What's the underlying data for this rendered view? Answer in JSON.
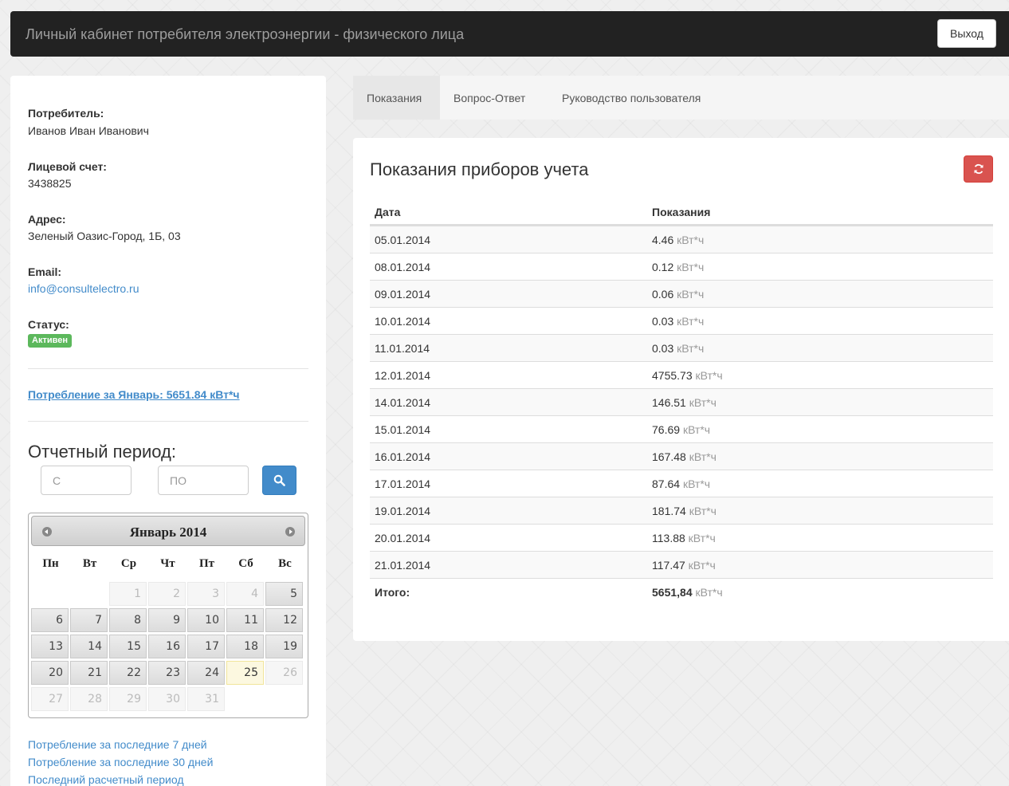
{
  "header": {
    "title": "Личный кабинет потребителя электроэнергии - физического лица",
    "logout_label": "Выход"
  },
  "sidebar": {
    "consumer_label": "Потребитель:",
    "consumer_value": "Иванов Иван Иванович",
    "account_label": "Лицевой счет:",
    "account_value": "3438825",
    "address_label": "Адрес:",
    "address_value": "Зеленый Оазис-Город, 1Б, 03",
    "email_label": "Email:",
    "email_value": "info@consultelectro.ru",
    "status_label": "Статус:",
    "status_value": "Активен",
    "consumption_text": "Потребление за Январь: 5651.84 кВт*ч",
    "period_title": "Отчетный период:",
    "from_placeholder": "С",
    "to_placeholder": "ПО",
    "links": [
      "Потребление за последние 7 дней",
      "Потребление за последние 30 дней",
      "Последний расчетный период"
    ]
  },
  "calendar": {
    "title": "Январь 2014",
    "weekdays": [
      "Пн",
      "Вт",
      "Ср",
      "Чт",
      "Пт",
      "Сб",
      "Вс"
    ],
    "weeks": [
      [
        "",
        "",
        "1",
        "2",
        "3",
        "4",
        "5"
      ],
      [
        "6",
        "7",
        "8",
        "9",
        "10",
        "11",
        "12"
      ],
      [
        "13",
        "14",
        "15",
        "16",
        "17",
        "18",
        "19"
      ],
      [
        "20",
        "21",
        "22",
        "23",
        "24",
        "25",
        "26"
      ],
      [
        "27",
        "28",
        "29",
        "30",
        "31",
        "",
        ""
      ]
    ],
    "disabled_days": [
      "1",
      "2",
      "3",
      "4",
      "26",
      "27",
      "28",
      "29",
      "30",
      "31"
    ],
    "today": "25"
  },
  "tabs": [
    {
      "label": "Показания",
      "active": true
    },
    {
      "label": "Вопрос-Ответ",
      "active": false
    },
    {
      "label": "Руководство пользователя",
      "active": false
    }
  ],
  "readings": {
    "title": "Показания приборов учета",
    "columns": [
      "Дата",
      "Показания"
    ],
    "unit": "кВт*ч",
    "rows": [
      {
        "date": "05.01.2014",
        "value": "4.46"
      },
      {
        "date": "08.01.2014",
        "value": "0.12"
      },
      {
        "date": "09.01.2014",
        "value": "0.06"
      },
      {
        "date": "10.01.2014",
        "value": "0.03"
      },
      {
        "date": "11.01.2014",
        "value": "0.03"
      },
      {
        "date": "12.01.2014",
        "value": "4755.73"
      },
      {
        "date": "14.01.2014",
        "value": "146.51"
      },
      {
        "date": "15.01.2014",
        "value": "76.69"
      },
      {
        "date": "16.01.2014",
        "value": "167.48"
      },
      {
        "date": "17.01.2014",
        "value": "87.64"
      },
      {
        "date": "19.01.2014",
        "value": "181.74"
      },
      {
        "date": "20.01.2014",
        "value": "113.88"
      },
      {
        "date": "21.01.2014",
        "value": "117.47"
      }
    ],
    "total_label": "Итого:",
    "total_value": "5651,84"
  },
  "colors": {
    "navbar": "#222222",
    "link": "#428bca",
    "status_badge": "#5cb85c",
    "refresh_button": "#d9534f",
    "search_button": "#428bca"
  }
}
